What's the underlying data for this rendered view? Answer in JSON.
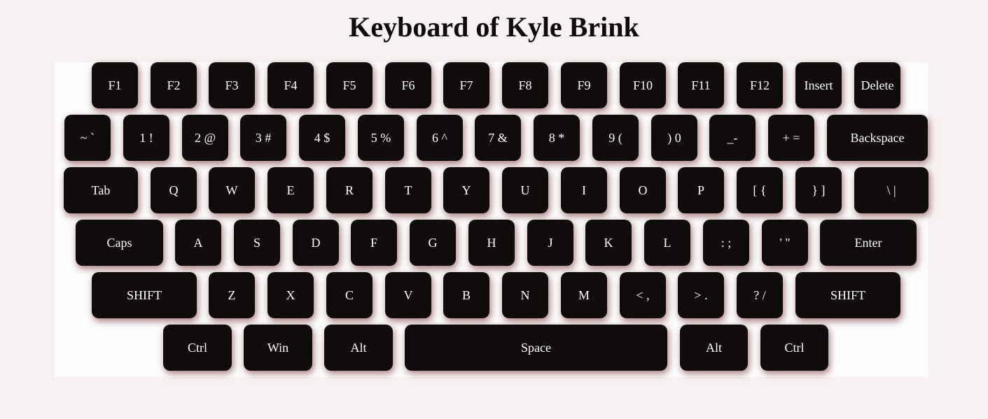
{
  "title": "Keyboard of Kyle Brink",
  "rows": [
    [
      "F1",
      "F2",
      "F3",
      "F4",
      "F5",
      "F6",
      "F7",
      "F8",
      "F9",
      "F10",
      "F11",
      "F12",
      "Insert",
      "Delete"
    ],
    [
      "~ `",
      "1 !",
      "2 @",
      "3 #",
      "4 $",
      "5 %",
      "6 ^",
      "7 &",
      "8 *",
      "9 (",
      ") 0",
      "_-",
      "+ =",
      "Backspace"
    ],
    [
      "Tab",
      "Q",
      "W",
      "E",
      "R",
      "T",
      "Y",
      "U",
      "I",
      "O",
      "P",
      "[ {",
      "} ]",
      "\\ |"
    ],
    [
      "Caps",
      "A",
      "S",
      "D",
      "F",
      "G",
      "H",
      "J",
      "K",
      "L",
      ": ;",
      "' \"",
      "Enter"
    ],
    [
      "SHIFT",
      "Z",
      "X",
      "C",
      "V",
      "B",
      "N",
      "M",
      "< ,",
      "> .",
      "? /",
      "SHIFT"
    ],
    [
      "Ctrl",
      "Win",
      "Alt",
      "Space",
      "Alt",
      "Ctrl"
    ]
  ]
}
